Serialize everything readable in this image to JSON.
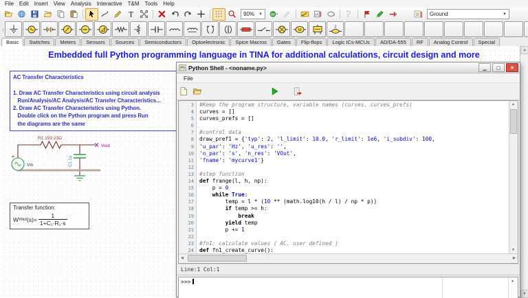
{
  "app": {
    "menu": [
      "File",
      "Edit",
      "Insert",
      "View",
      "Analysis",
      "Interactive",
      "T&M",
      "Tools",
      "Help"
    ],
    "toolbar": {
      "icons_left": [
        "open-file",
        "world-open",
        "save",
        "open-folder",
        "copy",
        "paste",
        "|",
        "!select-cursor",
        "wire-hook",
        "pencil",
        "text-tool",
        "polygon-select",
        "|",
        "delete-x",
        "undo",
        "redo",
        "crosshair",
        "|",
        "!grid-toggle",
        "zoom-magnifier"
      ],
      "zoom_value": "90%",
      "icons_mid": [
        "dc-meter",
        "~probe-pencil",
        "|",
        "interactive-switch",
        "logic-indicator",
        "loop-tool",
        "|",
        "~analysis-runner",
        "|",
        "flag-pin",
        "green-marker",
        "red-probe"
      ],
      "symbol_button_icon": "symbol-box",
      "ground_value": "Ground"
    },
    "components": {
      "icons": [
        "ground",
        "voltage-source",
        "battery",
        "voltmeter",
        "ammeter",
        "wattmeter",
        "resistor",
        "potentiometer",
        "capacitor",
        "inductor",
        "coupled-inductor",
        "transformer",
        "iron-transformer",
        "fuse",
        "switch",
        "lamp",
        "motor",
        "relay",
        "jumper-2"
      ],
      "empty_cells": 12
    },
    "tabs": [
      "Basic",
      "Switches",
      "Meters",
      "Sensors",
      "Sources",
      "Semiconductors",
      "Optoelectronic",
      "Spice Macros",
      "Gates",
      "Flip-flops",
      "Logic ICs-MCUs",
      "AD/DA-555",
      "RF",
      "Analog Control",
      "Special"
    ],
    "active_tab": "Basic"
  },
  "schematic": {
    "headline": "Embedded full Python programming language in TINA for additional calculations, circuit design and more",
    "instructions": [
      "AC Transfer Characteristics",
      "",
      "1. Draw AC Transfer Characteristics using circuit analysis",
      "   Run/Analysis/AC Analysis/AC Transfer Characteristics...",
      "2. Draw AC Transfer Characteristics using Python.",
      "   Double click on the Python program and press Run",
      "   the diagrams are the same"
    ],
    "circuit": {
      "source_label": "Vin",
      "resistor_label": "R1 159.23Ω",
      "capacitor_label": "C1 1u",
      "output_label": "Vout"
    },
    "transfer": {
      "title": "Transfer function:",
      "lhs": "W",
      "lhs_sub": "Vout",
      "equals": "(s)=",
      "numerator": "1",
      "denominator": "1+C₁·R₁·s"
    }
  },
  "python_shell": {
    "title": "Python Shell - <noname.py>",
    "menu": [
      "File"
    ],
    "toolbar_icons": [
      "new-file",
      "open-file2",
      "|",
      "run",
      "run-script"
    ],
    "status": "Line:1 Col:1",
    "prompt": ">>>",
    "code": {
      "first_line": 3,
      "lines": [
        [
          [
            "c",
            "#Keep the program structure, variable names (curves, curves_prefs)"
          ]
        ],
        [
          [
            "t",
            "curves = []"
          ]
        ],
        [
          [
            "t",
            "curves_prefs = []"
          ]
        ],
        [],
        [
          [
            "c",
            "#control data"
          ]
        ],
        [
          [
            "t",
            "draw_pref1 = {"
          ],
          [
            "s",
            "'typ'"
          ],
          [
            "t",
            ": "
          ],
          [
            "n",
            "2"
          ],
          [
            "t",
            ", "
          ],
          [
            "s",
            "'l_limit'"
          ],
          [
            "t",
            ": "
          ],
          [
            "n",
            "10.0"
          ],
          [
            "t",
            ", "
          ],
          [
            "s",
            "'r_limit'"
          ],
          [
            "t",
            ": "
          ],
          [
            "n",
            "1e6"
          ],
          [
            "t",
            ", "
          ],
          [
            "s",
            "'i_subdiv'"
          ],
          [
            "t",
            ": "
          ],
          [
            "n",
            "100"
          ],
          [
            "t",
            ","
          ]
        ],
        [
          [
            "s",
            "'u_par'"
          ],
          [
            "t",
            ": "
          ],
          [
            "s",
            "'Hz'"
          ],
          [
            "t",
            ", "
          ],
          [
            "s",
            "'u_res'"
          ],
          [
            "t",
            ": "
          ],
          [
            "s",
            "''"
          ],
          [
            "t",
            ","
          ]
        ],
        [
          [
            "s",
            "'n_par'"
          ],
          [
            "t",
            ": "
          ],
          [
            "s",
            "'s'"
          ],
          [
            "t",
            ", "
          ],
          [
            "s",
            "'n_res'"
          ],
          [
            "t",
            ": "
          ],
          [
            "s",
            "'VOut'"
          ],
          [
            "t",
            ","
          ]
        ],
        [
          [
            "s",
            "'fname'"
          ],
          [
            "t",
            ": "
          ],
          [
            "s",
            "'mycurve1'"
          ],
          [
            "t",
            "}"
          ]
        ],
        [],
        [
          [
            "c",
            "#step function"
          ]
        ],
        [
          [
            "k",
            "def"
          ],
          [
            "t",
            " frange(l, h, np):"
          ]
        ],
        [
          [
            "t",
            "    p = "
          ],
          [
            "n",
            "0"
          ]
        ],
        [
          [
            "t",
            "    "
          ],
          [
            "k",
            "while"
          ],
          [
            "t",
            " "
          ],
          [
            "b",
            "True"
          ],
          [
            "t",
            ":"
          ]
        ],
        [
          [
            "t",
            "        temp = l * ("
          ],
          [
            "n",
            "10"
          ],
          [
            "t",
            " ** (math.log10(h / l) / np * p))"
          ]
        ],
        [
          [
            "t",
            "        "
          ],
          [
            "k",
            "if"
          ],
          [
            "t",
            " temp >= h:"
          ]
        ],
        [
          [
            "t",
            "            "
          ],
          [
            "k",
            "break"
          ]
        ],
        [
          [
            "t",
            "        "
          ],
          [
            "k",
            "yield"
          ],
          [
            "t",
            " temp"
          ]
        ],
        [
          [
            "t",
            "        p += "
          ],
          [
            "n",
            "1"
          ]
        ],
        [],
        [
          [
            "c",
            "#fn1: calculate values ( AC, user defined )"
          ]
        ],
        [
          [
            "k",
            "def"
          ],
          [
            "t",
            " fn1_create_curve():"
          ]
        ]
      ]
    }
  }
}
